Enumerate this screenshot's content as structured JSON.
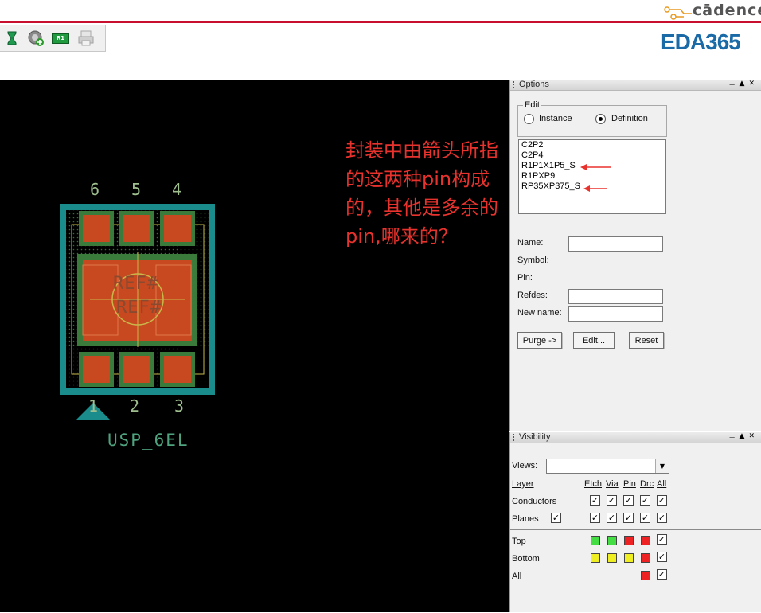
{
  "header": {
    "logo_cadence": "cādence",
    "logo_eda": "EDA365",
    "toolbar_icons": [
      "hourglass-icon",
      "add-component-icon",
      "r1-label-icon",
      "printer-icon"
    ],
    "toolbar_r1": "R1"
  },
  "canvas": {
    "pins_top": [
      "6",
      "5",
      "4"
    ],
    "pins_bottom": [
      "1",
      "2",
      "3"
    ],
    "ref_text_1": "REF#",
    "ref_text_2": "REF#",
    "package_name": "USP_6EL",
    "note": "封装中由箭头所指的这两种pin构成的，其他是多余的pin,哪来的？",
    "colors": {
      "background": "#000000",
      "outline": "#1a8c8c",
      "pad": "#c84820",
      "pad_border": "#3a7a3a",
      "text": "#9fbf8f",
      "note": "#e8322d"
    }
  },
  "options": {
    "title": "Options",
    "edit_group": "Edit",
    "radio_instance": "Instance",
    "radio_definition": "Definition",
    "definition_selected": true,
    "definitions": [
      "C2P2",
      "C2P4",
      "R1P1X1P5_S",
      "R1PXP9",
      "RP35XP375_S"
    ],
    "name_label": "Name:",
    "name_value": "",
    "symbol_label": "Symbol:",
    "pin_label": "Pin:",
    "refdes_label": "Refdes:",
    "refdes_value": "",
    "newname_label": "New name:",
    "newname_value": "",
    "purge_button": "Purge ->",
    "edit_button": "Edit...",
    "reset_button": "Reset"
  },
  "visibility": {
    "title": "Visibility",
    "views_label": "Views:",
    "views_value": "",
    "columns": [
      "Layer",
      "Etch",
      "Via",
      "Pin",
      "Drc",
      "All"
    ],
    "rows_a": [
      {
        "label": "Conductors",
        "checks": [
          true,
          true,
          true,
          true,
          true
        ]
      },
      {
        "label": "Planes",
        "checks": [
          true,
          true,
          true,
          true,
          true,
          true
        ]
      }
    ],
    "rows_b": [
      {
        "label": "Top",
        "colors": [
          "#44dd44",
          "#44dd44",
          "#ee2222",
          "#ee2222"
        ],
        "all": true
      },
      {
        "label": "Bottom",
        "colors": [
          "#eeee22",
          "#eeee22",
          "#eeee22",
          "#ee2222"
        ],
        "all": true
      },
      {
        "label": "All",
        "colors": [
          "#ee2222"
        ],
        "all": true
      }
    ]
  }
}
